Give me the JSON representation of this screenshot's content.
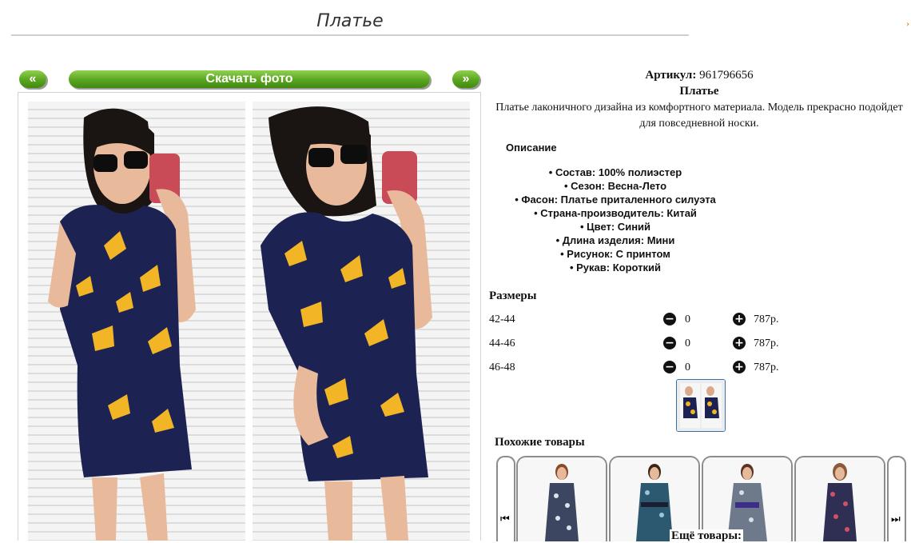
{
  "header": {
    "title": "Платье"
  },
  "gallery": {
    "prev_label": "«",
    "next_label": "»",
    "download_label": "Скачать фото"
  },
  "product": {
    "sku_label": "Артикул:",
    "sku_value": "961796656",
    "name": "Платье",
    "short_description": "Платье лаконичного дизайна из комфортного материала. Модель прекрасно подойдет для повседневной носки.",
    "description_heading": "Описание",
    "features": [
      "Состав: 100% полиэстер",
      "Сезон: Весна-Лето",
      "Фасон: Платье приталенного силуэта",
      "Страна-производитель: Китай",
      "Цвет: Синий",
      "Длина изделия: Мини",
      "Рисунок: С принтом",
      "Рукав: Короткий"
    ]
  },
  "sizes": {
    "heading": "Размеры",
    "rows": [
      {
        "size": "42-44",
        "qty": "0",
        "price": "787р."
      },
      {
        "size": "44-46",
        "qty": "0",
        "price": "787р."
      },
      {
        "size": "46-48",
        "qty": "0",
        "price": "787р."
      }
    ]
  },
  "similar": {
    "heading": "Похожие товары",
    "more_label": "Ещё товары:",
    "prev_icon": "skip-back-icon",
    "next_icon": "skip-forward-icon"
  },
  "colors": {
    "accent_green": "#5aa520",
    "dress_navy": "#1c2352",
    "flower_yellow": "#f2b526"
  }
}
